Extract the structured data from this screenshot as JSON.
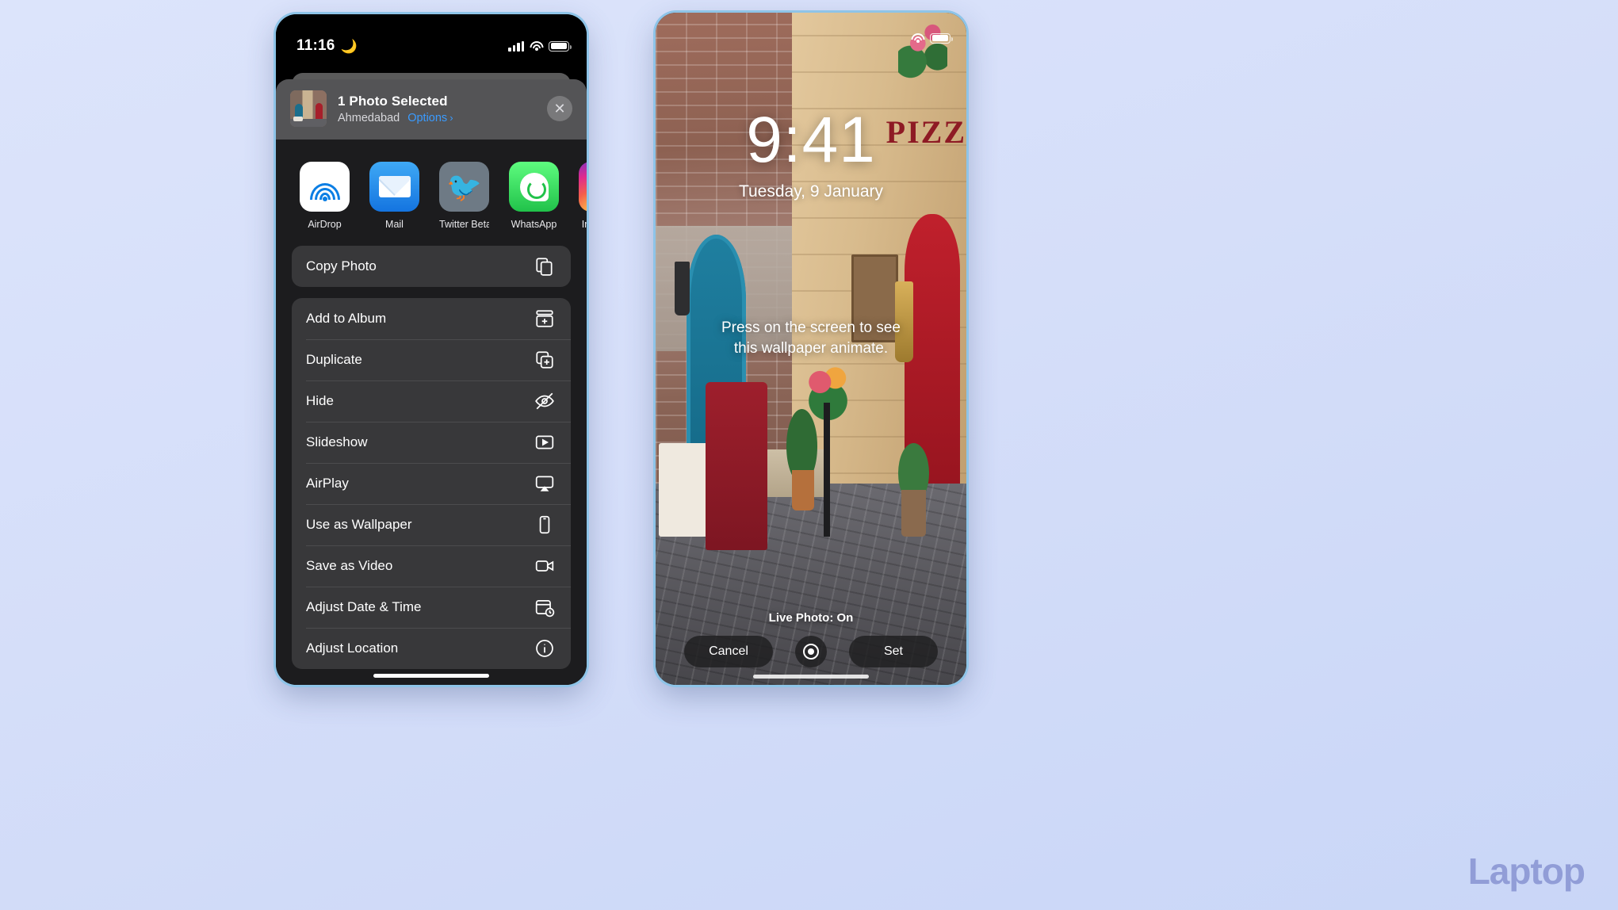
{
  "left_phone": {
    "status_bar": {
      "time": "11:16",
      "moon_icon": "crescent-moon-icon",
      "signal_icon": "cellular-signal-icon",
      "wifi_icon": "wifi-icon",
      "battery_icon": "battery-full-icon"
    },
    "share_sheet": {
      "title": "1 Photo Selected",
      "location": "Ahmedabad",
      "options_label": "Options",
      "options_chevron": "›",
      "close_icon": "✕",
      "thumbnail_name": "selected-photo-thumbnail",
      "apps": [
        {
          "label": "AirDrop",
          "icon": "airdrop-icon"
        },
        {
          "label": "Mail",
          "icon": "mail-icon"
        },
        {
          "label": "Twitter Beta",
          "icon": "twitter-icon"
        },
        {
          "label": "WhatsApp",
          "icon": "whatsapp-icon"
        },
        {
          "label": "Instagram",
          "icon": "instagram-icon"
        }
      ],
      "action_groups": [
        [
          {
            "label": "Copy Photo",
            "icon": "copy-icon"
          }
        ],
        [
          {
            "label": "Add to Album",
            "icon": "add-to-album-icon"
          },
          {
            "label": "Duplicate",
            "icon": "duplicate-icon"
          },
          {
            "label": "Hide",
            "icon": "hide-eye-icon"
          },
          {
            "label": "Slideshow",
            "icon": "slideshow-play-icon"
          },
          {
            "label": "AirPlay",
            "icon": "airplay-icon"
          },
          {
            "label": "Use as Wallpaper",
            "icon": "wallpaper-phone-icon"
          },
          {
            "label": "Save as Video",
            "icon": "video-camera-icon"
          },
          {
            "label": "Adjust Date & Time",
            "icon": "calendar-clock-icon"
          },
          {
            "label": "Adjust Location",
            "icon": "location-info-icon"
          }
        ]
      ]
    }
  },
  "right_phone": {
    "lock_screen": {
      "time": "9:41",
      "date": "Tuesday, 9 January",
      "hint_line_1": "Press on the screen to see",
      "hint_line_2": "this wallpaper animate.",
      "live_photo_status": "Live Photo: On",
      "cancel_label": "Cancel",
      "set_label": "Set",
      "live_toggle_icon": "live-photo-toggle-icon",
      "wallpaper_sign_text": "PIZZ"
    }
  },
  "watermark": {
    "text": "Laptop",
    "color": "#8e9ad6"
  },
  "colors": {
    "page_background": "#d7e0fa",
    "sheet_background": "#1c1c1e",
    "sheet_header": "#545456",
    "action_group": "#38383a",
    "accent_blue": "#3a9bff",
    "frame_border": "#8ec4e8"
  }
}
